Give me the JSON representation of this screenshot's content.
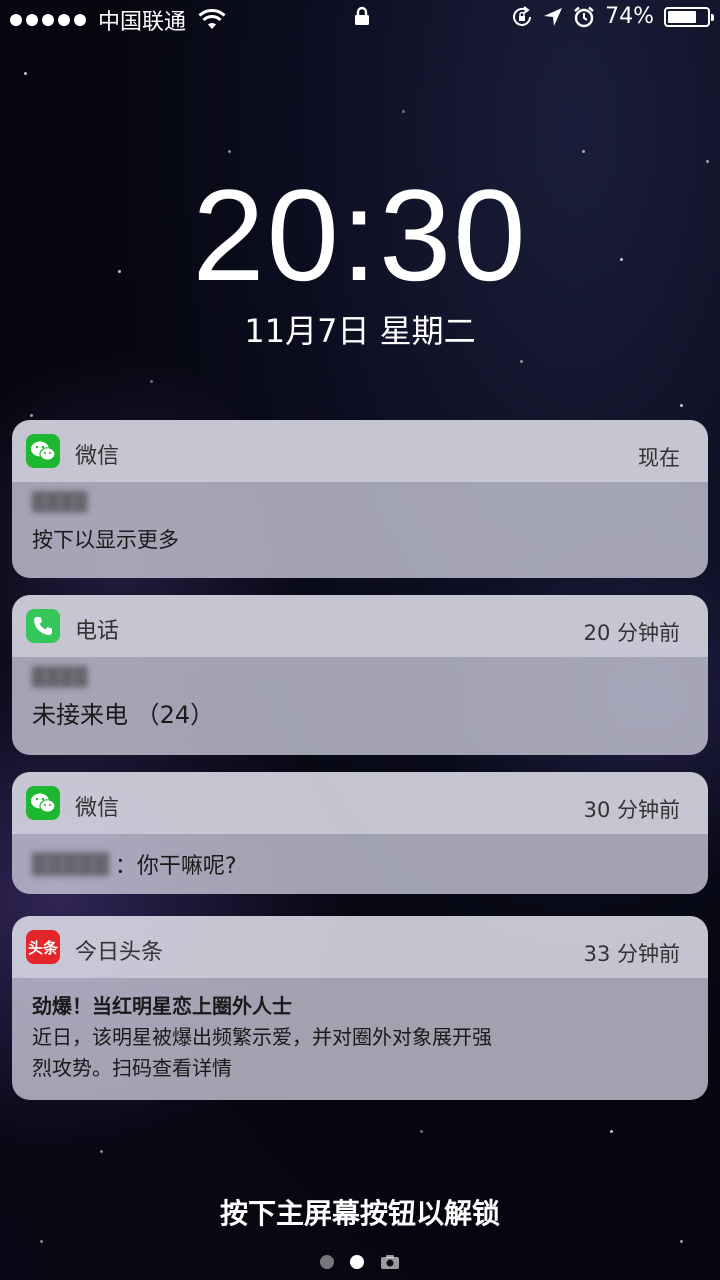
{
  "status_bar": {
    "carrier": "中国联通",
    "battery_percent": "74%",
    "battery_level": 0.74
  },
  "lockscreen": {
    "time": "20:30",
    "date": "11月7日 星期二",
    "unlock_hint": "按下主屏幕按钮以解锁"
  },
  "notifications": [
    {
      "app": "微信",
      "time": "现在",
      "body": "按下以显示更多",
      "icon": "wechat-icon"
    },
    {
      "app": "电话",
      "time": "20 分钟前",
      "body": "未接来电 （24）",
      "icon": "phone-icon"
    },
    {
      "app": "微信",
      "time": "30 分钟前",
      "body": "：你干嘛呢?",
      "icon": "wechat-icon"
    },
    {
      "app": "今日头条",
      "time": "33 分钟前",
      "title": "劲爆！当红明星恋上圈外人士",
      "body_line1": "近日，该明星被爆出频繁示爱，并对圈外对象展开强",
      "body_line2": "烈攻势。扫码查看详情",
      "icon": "toutiao-icon",
      "icon_text": "头条"
    }
  ],
  "colors": {
    "wechat": "#1db82f",
    "phone": "#35c759",
    "toutiao": "#e5242b"
  }
}
